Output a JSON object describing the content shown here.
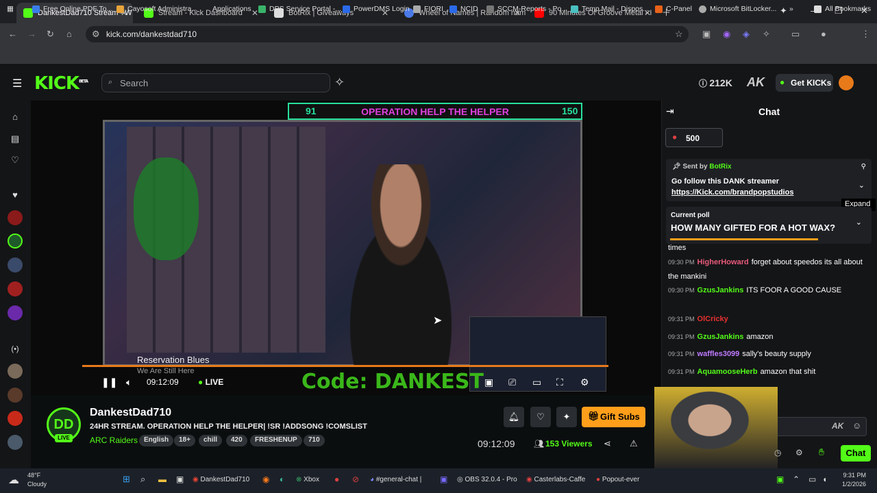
{
  "browser": {
    "tabs": [
      {
        "label": "DankestDad710 Stream - W",
        "color": "#53fc18",
        "active": true
      },
      {
        "label": "Stream - Kick Dashboard",
        "color": "#53fc18"
      },
      {
        "label": "BotRix | Giveaways",
        "color": "#e0e0e0"
      },
      {
        "label": "Wheel of Names | Random nam",
        "color": "#4a7ae8"
      },
      {
        "label": "90 Minutes Of Groove Metal - I",
        "color": "#ff0000"
      }
    ],
    "url": "kick.com/dankestdad710",
    "bookmarks": [
      "Free Online PDF To...",
      "Cayosoft Administra...",
      "Applications",
      "DPS Service Portal -...",
      "PowerDMS Login",
      "FIORI",
      "NCID",
      "SCCM-Reports - Po...",
      "Temp Mail - Dispos...",
      "C-Panel",
      "Microsoft BitLocker...",
      "All Bookmarks"
    ]
  },
  "header": {
    "logo": "KICK",
    "logo_badge": "BETA",
    "search_placeholder": "Search",
    "points": "212K",
    "get_kicks": "Get KICKs"
  },
  "player": {
    "banner_text": "OPERATION HELP THE HELPER",
    "banner_left": "91",
    "banner_right": "150",
    "song_title": "Reservation Blues",
    "song_artist": "We Are Still Here",
    "code_text": "Code: DANKEST",
    "time": "09:12:09",
    "live": "LIVE"
  },
  "stream": {
    "avatar": "DD",
    "live_badge": "LIVE",
    "username": "DankestDad710",
    "title": "24HR STREAM. OPERATION HELP THE HELPER| !SR !ADDSONG !COMSLIST",
    "category": "ARC Raiders",
    "tags": [
      "English",
      "18+",
      "chill",
      "420",
      "FRESHENUP",
      "710"
    ],
    "uptime": "09:12:09",
    "viewers": "153 Viewers",
    "gift_subs": "Gift Subs"
  },
  "chat": {
    "title": "Chat",
    "goal": "500",
    "pinned": {
      "sent_by": "Sent by",
      "bot": "BotRix",
      "text": "Go follow this DANK streamer",
      "link": "https://Kick.com/brandpopstudios",
      "expand": "Expand"
    },
    "poll": {
      "label": "Current poll",
      "question": "HOW MANY GIFTED FOR A HOT WAX?",
      "progress": 0.75
    },
    "messages": [
      {
        "time": "",
        "user": "",
        "color": "#fff",
        "text": "times"
      },
      {
        "time": "09:30 PM",
        "user": "HigherHoward",
        "color": "#e85a7a",
        "text": "forget about speedos its all about the mankini"
      },
      {
        "time": "09:30 PM",
        "user": "GzusJankins",
        "color": "#53fc18",
        "text": "ITS FOOR A GOOD CAUSE"
      },
      {
        "time": "09:31 PM",
        "user": "OlCricky",
        "color": "#e83030",
        "text": ""
      },
      {
        "time": "09:31 PM",
        "user": "GzusJankins",
        "color": "#53fc18",
        "text": "amazon"
      },
      {
        "time": "09:31 PM",
        "user": "waffles3099",
        "color": "#c07aff",
        "text": "sally's beauty supply"
      },
      {
        "time": "09:31 PM",
        "user": "AquamooseHerb",
        "color": "#53fc18",
        "text": "amazon that shit"
      }
    ],
    "send": "Chat"
  },
  "taskbar": {
    "weather_temp": "48°F",
    "weather_desc": "Cloudy",
    "apps": [
      "DankestDad710",
      "Xbox",
      "#general-chat |",
      "OBS 32.0.4 - Pro",
      "Casterlabs-Caffe",
      "Popout-ever"
    ],
    "clock_time": "9:31 PM",
    "clock_date": "1/2/2026"
  }
}
